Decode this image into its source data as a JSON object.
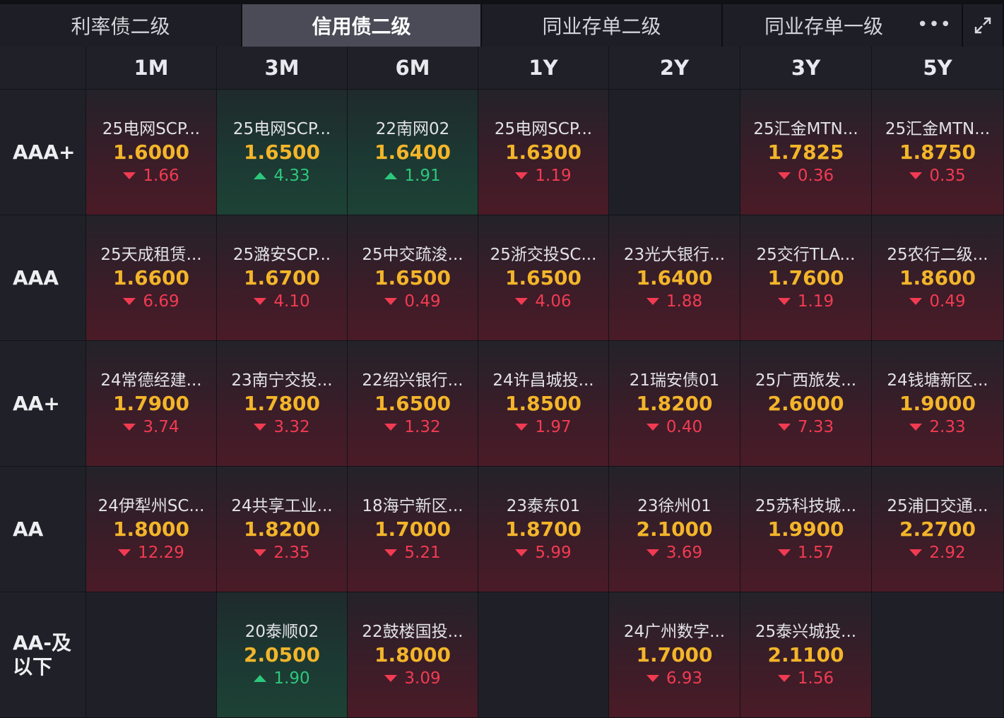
{
  "tabs": [
    {
      "label": "利率债二级",
      "active": false
    },
    {
      "label": "信用债二级",
      "active": true
    },
    {
      "label": "同业存单二级",
      "active": false
    },
    {
      "label": "同业存单一级",
      "active": false
    }
  ],
  "more_icon": "more-horizontal-icon",
  "expand_icon": "expand-icon",
  "tenors": [
    "1M",
    "3M",
    "6M",
    "1Y",
    "2Y",
    "3Y",
    "5Y"
  ],
  "colors": {
    "price": "#f3b52a",
    "down": "#f23b52",
    "up": "#2dc77c",
    "active_tab": "#4a4b57"
  },
  "rows": [
    {
      "rating": "AAA+",
      "cells": [
        {
          "name": "25电网SCP...",
          "price": "1.6000",
          "change": "1.66",
          "dir": "down"
        },
        {
          "name": "25电网SCP...",
          "price": "1.6500",
          "change": "4.33",
          "dir": "up"
        },
        {
          "name": "22南网02",
          "price": "1.6400",
          "change": "1.91",
          "dir": "up"
        },
        {
          "name": "25电网SCP...",
          "price": "1.6300",
          "change": "1.19",
          "dir": "down"
        },
        null,
        {
          "name": "25汇金MTN...",
          "price": "1.7825",
          "change": "0.36",
          "dir": "down"
        },
        {
          "name": "25汇金MTN...",
          "price": "1.8750",
          "change": "0.35",
          "dir": "down"
        }
      ]
    },
    {
      "rating": "AAA",
      "cells": [
        {
          "name": "25天成租赁...",
          "price": "1.6600",
          "change": "6.69",
          "dir": "down"
        },
        {
          "name": "25潞安SCP...",
          "price": "1.6700",
          "change": "4.10",
          "dir": "down"
        },
        {
          "name": "25中交疏浚...",
          "price": "1.6500",
          "change": "0.49",
          "dir": "down"
        },
        {
          "name": "25浙交投SC...",
          "price": "1.6500",
          "change": "4.06",
          "dir": "down"
        },
        {
          "name": "23光大银行...",
          "price": "1.6400",
          "change": "1.88",
          "dir": "down"
        },
        {
          "name": "25交行TLA...",
          "price": "1.7600",
          "change": "1.19",
          "dir": "down"
        },
        {
          "name": "25农行二级...",
          "price": "1.8600",
          "change": "0.49",
          "dir": "down"
        }
      ]
    },
    {
      "rating": "AA+",
      "cells": [
        {
          "name": "24常德经建...",
          "price": "1.7900",
          "change": "3.74",
          "dir": "down"
        },
        {
          "name": "23南宁交投...",
          "price": "1.7800",
          "change": "3.32",
          "dir": "down"
        },
        {
          "name": "22绍兴银行...",
          "price": "1.6500",
          "change": "1.32",
          "dir": "down"
        },
        {
          "name": "24许昌城投...",
          "price": "1.8500",
          "change": "1.97",
          "dir": "down"
        },
        {
          "name": "21瑞安债01",
          "price": "1.8200",
          "change": "0.40",
          "dir": "down"
        },
        {
          "name": "25广西旅发...",
          "price": "2.6000",
          "change": "7.33",
          "dir": "down"
        },
        {
          "name": "24钱塘新区...",
          "price": "1.9000",
          "change": "2.33",
          "dir": "down"
        }
      ]
    },
    {
      "rating": "AA",
      "cells": [
        {
          "name": "24伊犁州SC...",
          "price": "1.8000",
          "change": "12.29",
          "dir": "down"
        },
        {
          "name": "24共享工业...",
          "price": "1.8200",
          "change": "2.35",
          "dir": "down"
        },
        {
          "name": "18海宁新区...",
          "price": "1.7000",
          "change": "5.21",
          "dir": "down"
        },
        {
          "name": "23泰东01",
          "price": "1.8700",
          "change": "5.99",
          "dir": "down"
        },
        {
          "name": "23徐州01",
          "price": "2.1000",
          "change": "3.69",
          "dir": "down"
        },
        {
          "name": "25苏科技城...",
          "price": "1.9900",
          "change": "1.57",
          "dir": "down"
        },
        {
          "name": "25浦口交通...",
          "price": "2.2700",
          "change": "2.92",
          "dir": "down"
        }
      ]
    },
    {
      "rating": "AA-及以下",
      "cells": [
        null,
        {
          "name": "20泰顺02",
          "price": "2.0500",
          "change": "1.90",
          "dir": "up"
        },
        {
          "name": "22鼓楼国投...",
          "price": "1.8000",
          "change": "3.09",
          "dir": "down"
        },
        null,
        {
          "name": "24广州数字...",
          "price": "1.7000",
          "change": "6.93",
          "dir": "down"
        },
        {
          "name": "25泰兴城投...",
          "price": "2.1100",
          "change": "1.56",
          "dir": "down"
        },
        null
      ]
    }
  ]
}
